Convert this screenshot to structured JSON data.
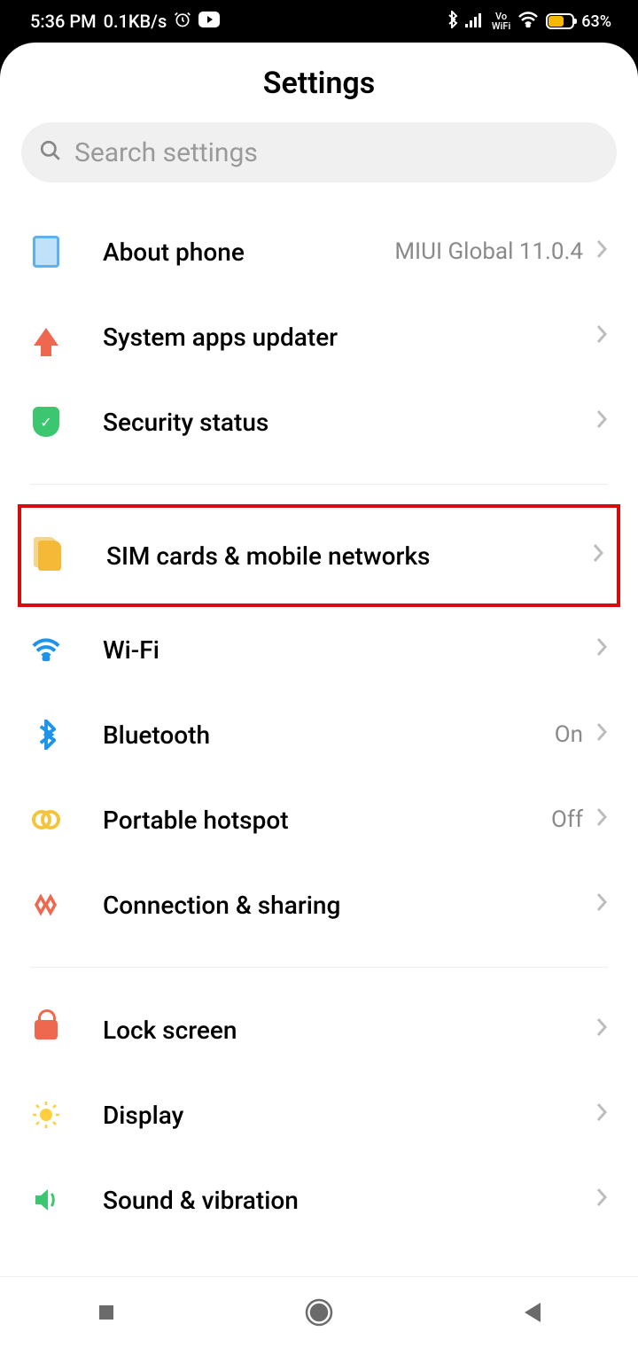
{
  "status": {
    "time": "5:36 PM",
    "speed": "0.1KB/s",
    "battery_pct": "63%",
    "vowifi": "Vo WiFi"
  },
  "page_title": "Settings",
  "search": {
    "placeholder": "Search settings"
  },
  "items": {
    "about": {
      "label": "About phone",
      "value": "MIUI Global 11.0.4"
    },
    "updater": {
      "label": "System apps updater",
      "value": ""
    },
    "security": {
      "label": "Security status",
      "value": ""
    },
    "sim": {
      "label": "SIM cards & mobile networks",
      "value": ""
    },
    "wifi": {
      "label": "Wi-Fi",
      "value": ""
    },
    "bt": {
      "label": "Bluetooth",
      "value": "On"
    },
    "hotspot": {
      "label": "Portable hotspot",
      "value": "Off"
    },
    "conn": {
      "label": "Connection & sharing",
      "value": ""
    },
    "lock": {
      "label": "Lock screen",
      "value": ""
    },
    "display": {
      "label": "Display",
      "value": ""
    },
    "sound": {
      "label": "Sound & vibration",
      "value": ""
    }
  }
}
